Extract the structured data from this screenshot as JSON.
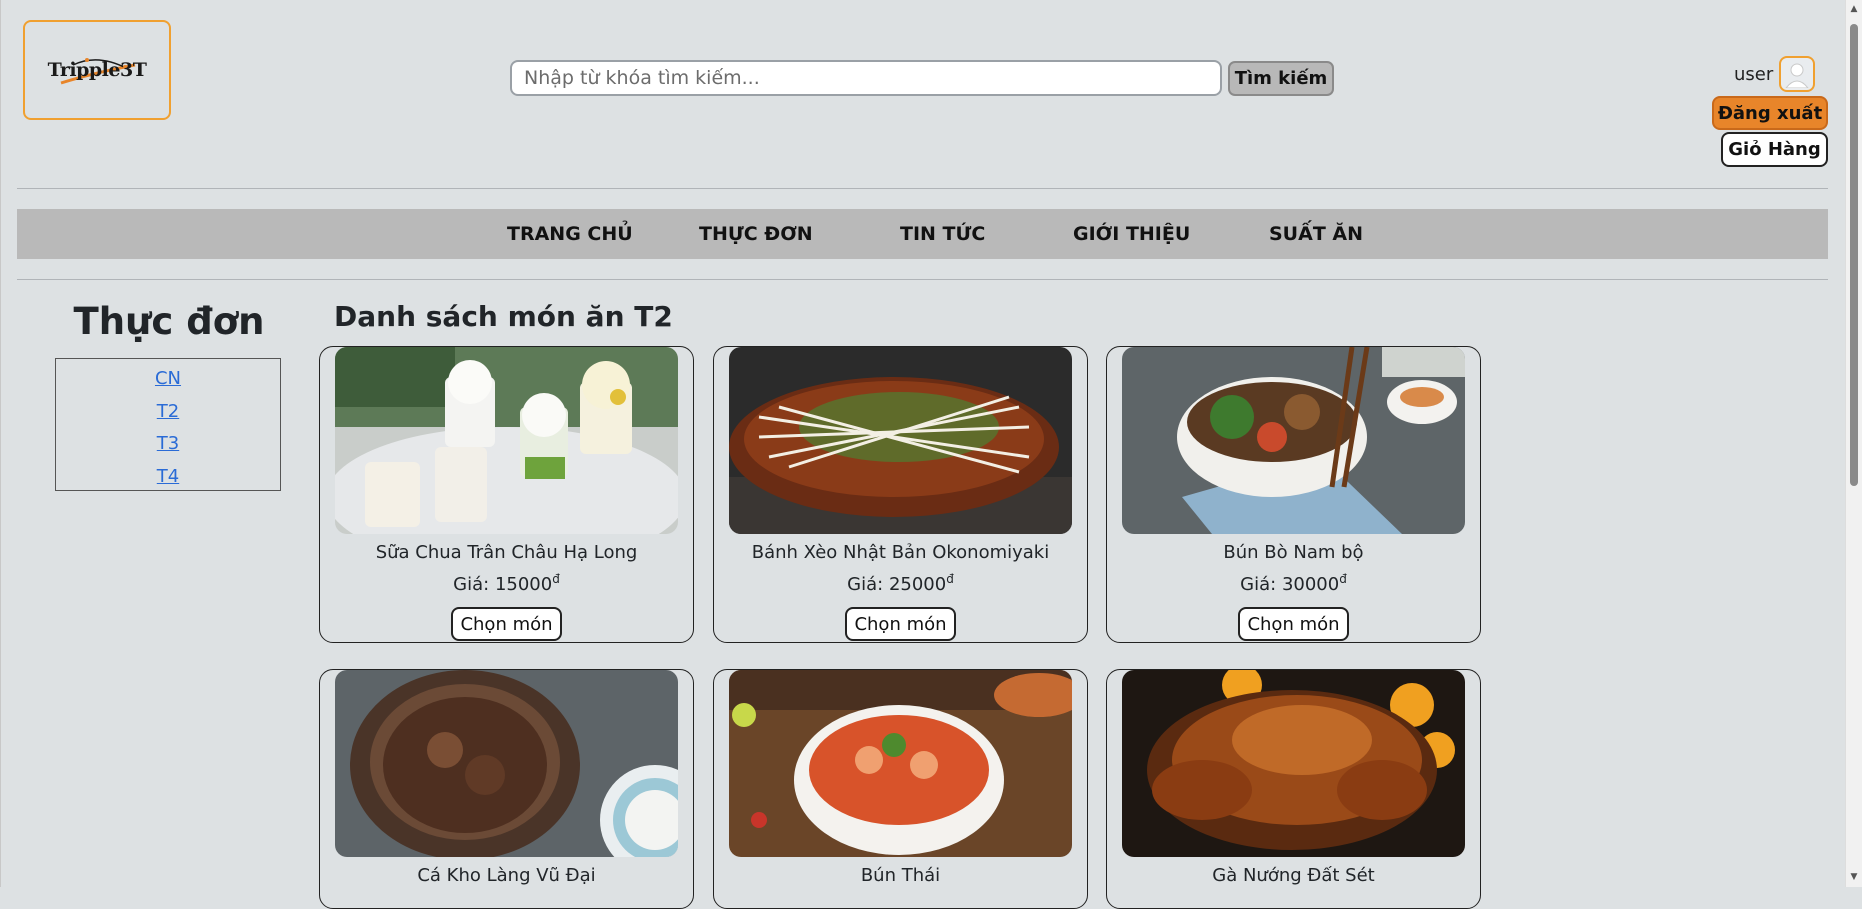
{
  "header": {
    "logo_text": "Tripple3T",
    "search": {
      "placeholder": "Nhập từ khóa tìm kiếm...",
      "value": ""
    },
    "search_button": "Tìm kiếm",
    "user_label": "user",
    "logout_button": "Đăng xuất",
    "cart_button": "Giỏ Hàng"
  },
  "nav": {
    "items": [
      "TRANG CHỦ",
      "THỰC ĐƠN",
      "TIN TỨC",
      "GIỚI THIỆU",
      "SUẤT ĂN"
    ]
  },
  "sidebar": {
    "title": "Thực đơn",
    "links": [
      "CN",
      "T2",
      "T3",
      "T4"
    ]
  },
  "main": {
    "title": "Danh sách món ăn T2",
    "price_prefix": "Giá: ",
    "currency": "đ",
    "choose_label": "Chọn món",
    "items": [
      {
        "name": "Sữa Chua Trân Châu Hạ Long",
        "price": "15000"
      },
      {
        "name": "Bánh Xèo Nhật Bản Okonomiyaki",
        "price": "25000"
      },
      {
        "name": "Bún Bò Nam bộ",
        "price": "30000"
      },
      {
        "name": "Cá Kho Làng Vũ Đại",
        "price": ""
      },
      {
        "name": "Bún Thái",
        "price": ""
      },
      {
        "name": "Gà Nướng Đất Sét",
        "price": ""
      }
    ]
  },
  "colors": {
    "background": "#dde1e3",
    "accent_orange": "#e8852a",
    "nav_bg": "#b9b9b9",
    "link_blue": "#2a6bd6"
  }
}
